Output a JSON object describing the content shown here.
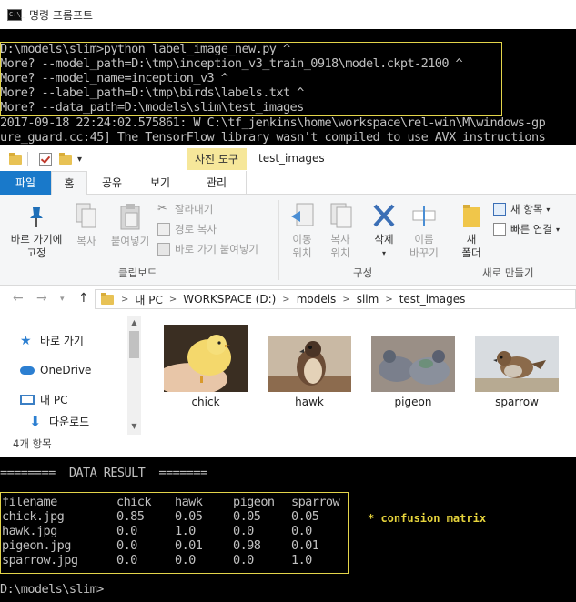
{
  "cmd_top": {
    "window_title": "명령 프롬프트",
    "lines": [
      "D:\\models\\slim>python label_image_new.py ^",
      "More? --model_path=D:\\tmp\\inception_v3_train_0918\\model.ckpt-2100 ^",
      "More? --model_name=inception_v3 ^",
      "More? --label_path=D:\\tmp\\birds\\labels.txt ^",
      "More? --data_path=D:\\models\\slim\\test_images",
      "2017-09-18 22:24:02.575861: W C:\\tf_jenkins\\home\\workspace\\rel-win\\M\\windows-gp",
      "ure_guard.cc:45] The TensorFlow library wasn't compiled to use AVX instructions"
    ]
  },
  "explorer": {
    "context_tab": "사진 도구",
    "window_path_title": "test_images",
    "tabs": {
      "file": "파일",
      "home": "홈",
      "share": "공유",
      "view": "보기",
      "manage": "관리"
    },
    "ribbon": {
      "pin_quick_access": "바로 가기에\n고정",
      "copy": "복사",
      "paste": "붙여넣기",
      "cut": "잘라내기",
      "copy_path": "경로 복사",
      "paste_shortcut": "바로 가기 붙여넣기",
      "move_to": "이동\n위치",
      "copy_to": "복사\n위치",
      "delete": "삭제",
      "rename": "이름\n바꾸기",
      "new_folder": "새\n폴더",
      "new_item": "새 항목",
      "easy_access": "빠른 연결",
      "group_clipboard": "클립보드",
      "group_organize": "구성",
      "group_new": "새로 만들기"
    },
    "address": [
      "내 PC",
      "WORKSPACE (D:)",
      "models",
      "slim",
      "test_images"
    ],
    "nav": {
      "quick_access": "바로 가기",
      "onedrive": "OneDrive",
      "this_pc": "내 PC",
      "downloads": "다운로드"
    },
    "files": [
      "chick",
      "hawk",
      "pigeon",
      "sparrow"
    ],
    "status": "4개 항목"
  },
  "cmd_bottom": {
    "header": "========  DATA RESULT  =======",
    "columns": [
      "filename",
      "chick",
      "hawk",
      "pigeon",
      "sparrow"
    ],
    "rows": [
      [
        "chick.jpg",
        "0.85",
        "0.05",
        "0.05",
        "0.05"
      ],
      [
        "hawk.jpg",
        "0.0",
        "1.0",
        "0.0",
        "0.0"
      ],
      [
        "pigeon.jpg",
        "0.0",
        "0.01",
        "0.98",
        "0.01"
      ],
      [
        "sparrow.jpg",
        "0.0",
        "0.0",
        "0.0",
        "1.0"
      ]
    ],
    "annotation": "* confusion matrix",
    "prompt": "D:\\models\\slim>"
  },
  "colors": {
    "highlight_border": "#e3d44a",
    "file_tab": "#1979ca",
    "context_tab": "#f6e79a"
  }
}
